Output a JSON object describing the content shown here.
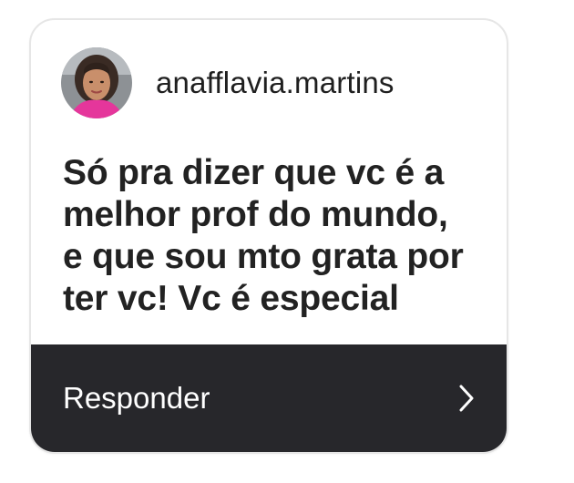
{
  "story_reply": {
    "username": "anafflavia.martins",
    "avatar_icon": "profile-photo",
    "message": "Só pra dizer que vc é a\nmelhor prof do mundo,\ne que sou mto grata por\nter vc! Vc é especial",
    "reply_label": "Responder",
    "reply_icon": "chevron-right-icon"
  },
  "colors": {
    "reply_bar": "#27272b",
    "card_border": "#e6e6e6",
    "text": "#222222"
  }
}
